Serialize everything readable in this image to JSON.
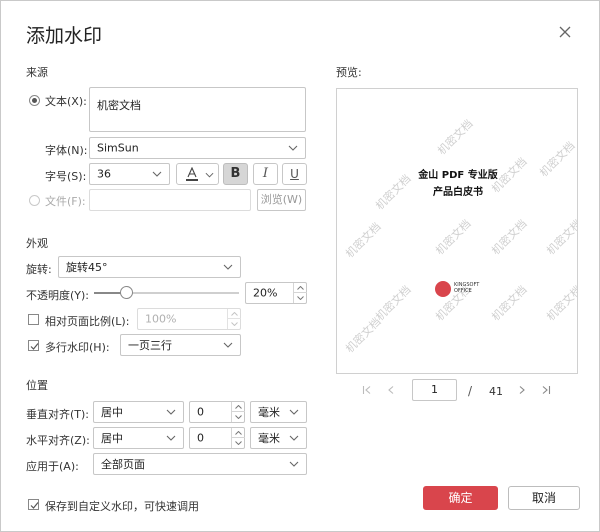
{
  "dialog": {
    "title": "添加水印",
    "close_icon": "close-icon"
  },
  "source": {
    "heading": "来源",
    "text_option_label": "文本(X):",
    "text_value": "机密文档",
    "font_label": "字体(N):",
    "font_value": "SimSun",
    "size_label": "字号(S):",
    "size_value": "36",
    "color_icon": "font-color-icon",
    "bold_label": "B",
    "italic_label": "I",
    "underline_label": "U",
    "file_option_label": "文件(F):",
    "file_value": "",
    "browse_label": "浏览(W)"
  },
  "appearance": {
    "heading": "外观",
    "rotation_label": "旋转:",
    "rotation_value": "旋转45°",
    "opacity_label": "不透明度(Y):",
    "opacity_value": "20%",
    "opacity_fraction": 0.2,
    "relative_scale_label": "相对页面比例(L):",
    "relative_scale_value": "100%",
    "relative_scale_checked": false,
    "multiline_label": "多行水印(H):",
    "multiline_checked": true,
    "multiline_value": "一页三行"
  },
  "position": {
    "heading": "位置",
    "vertical_label": "垂直对齐(T):",
    "vertical_value": "居中",
    "vertical_offset": "0",
    "vertical_unit": "毫米",
    "horizontal_label": "水平对齐(Z):",
    "horizontal_value": "居中",
    "horizontal_offset": "0",
    "horizontal_unit": "毫米",
    "apply_label": "应用于(A):",
    "apply_value": "全部页面"
  },
  "preview": {
    "heading": "预览:",
    "doc_title_line1": "金山 PDF 专业版",
    "doc_title_line2": "产品白皮书",
    "logo_text_line1": "KINGSOFT",
    "logo_text_line2": "OFFICE",
    "watermark_text": "机密文档",
    "page_current": "1",
    "page_separator": "/",
    "page_total": "41"
  },
  "footer": {
    "save_custom_label": "保存到自定义水印，可快速调用",
    "save_custom_checked": true,
    "ok_label": "确定",
    "cancel_label": "取消"
  },
  "colors": {
    "accent": "#d9454c",
    "check": "#555555"
  }
}
